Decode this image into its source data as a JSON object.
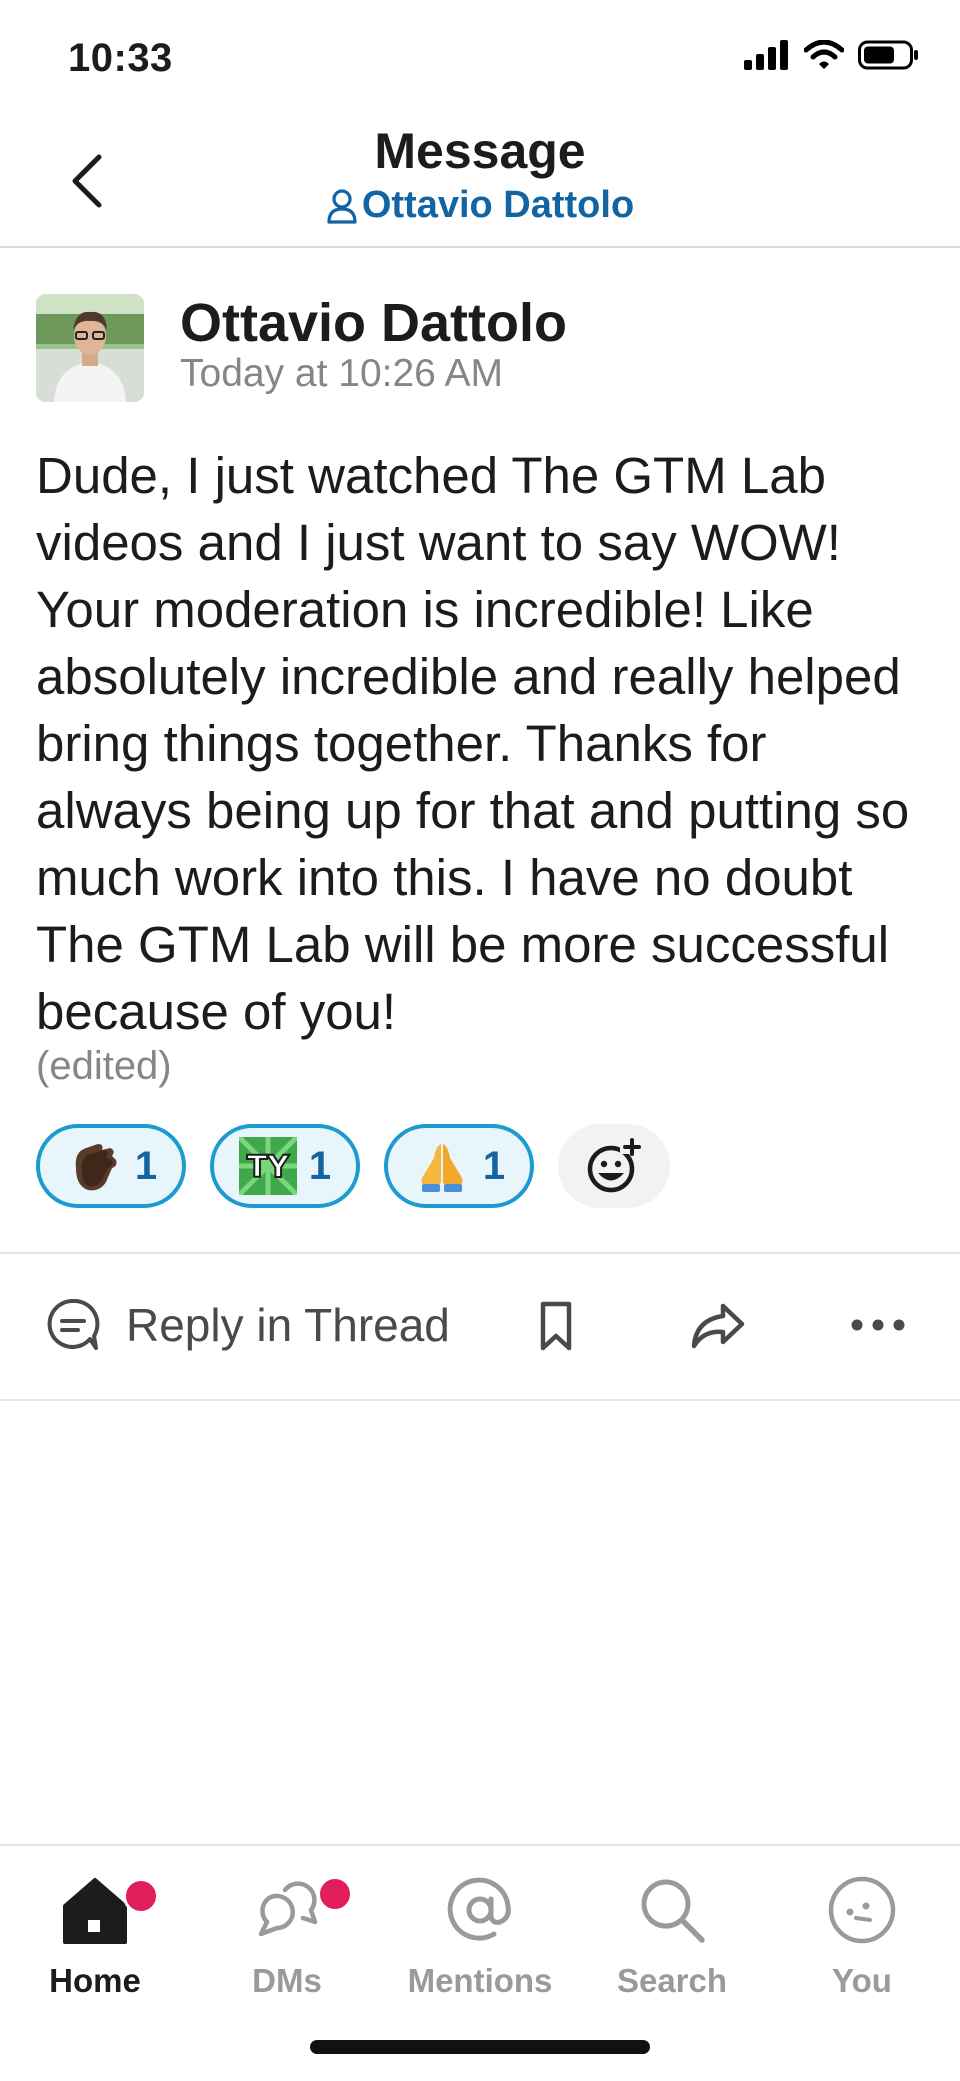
{
  "status_bar": {
    "time": "10:33"
  },
  "header": {
    "title": "Message",
    "subtitle": "Ottavio Dattolo"
  },
  "message": {
    "sender": "Ottavio Dattolo",
    "timestamp": "Today at 10:26 AM",
    "body": "Dude, I just watched The GTM Lab videos and I just want to say WOW! Your moderation is incredible! Like absolutely incredible and really helped bring things together. Thanks for always being up for that and putting so much work into this. I have no doubt The GTM Lab will be more successful because of you!",
    "edited": "(edited)",
    "reactions": [
      {
        "emoji": "clapping-hands-icon",
        "count": "1"
      },
      {
        "emoji": "ty-icon",
        "count": "1"
      },
      {
        "emoji": "folded-hands-icon",
        "count": "1"
      }
    ]
  },
  "actions": {
    "reply_label": "Reply in Thread"
  },
  "tabs": [
    {
      "label": "Home",
      "active": true,
      "badge": true
    },
    {
      "label": "DMs",
      "active": false,
      "badge": true
    },
    {
      "label": "Mentions",
      "active": false,
      "badge": false
    },
    {
      "label": "Search",
      "active": false,
      "badge": false
    },
    {
      "label": "You",
      "active": false,
      "badge": false
    }
  ],
  "colors": {
    "link": "#1264a3",
    "reaction_border": "#1d9bd1",
    "badge": "#e01e5a"
  }
}
